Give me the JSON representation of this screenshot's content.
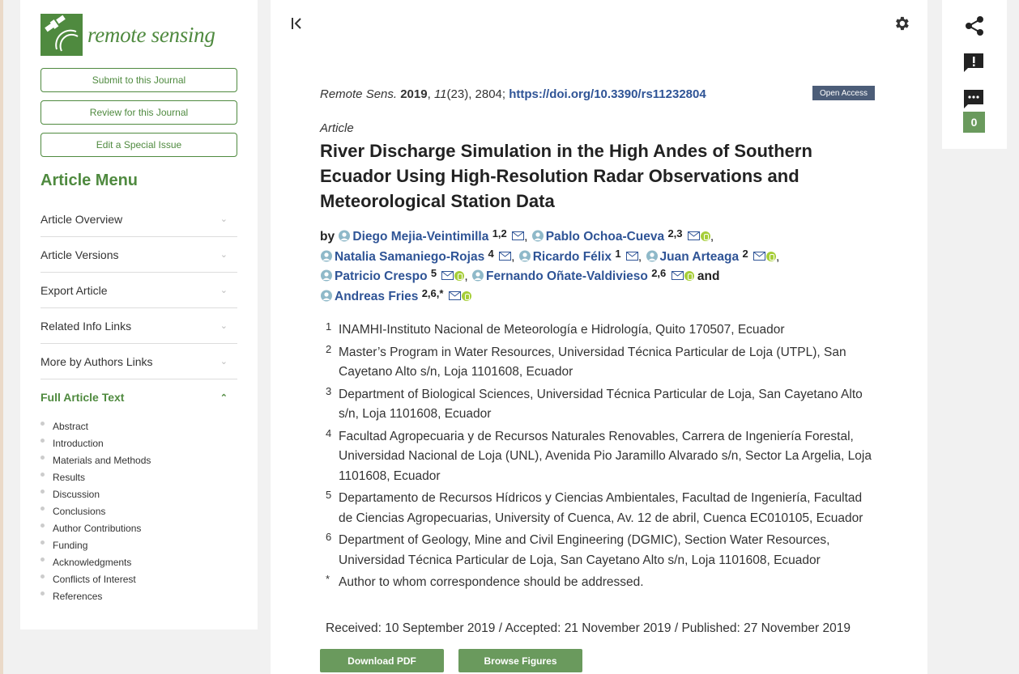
{
  "journal": {
    "name": "remote sensing"
  },
  "sidebar": {
    "buttons": [
      "Submit to this Journal",
      "Review for this Journal",
      "Edit a Special Issue"
    ],
    "menu_title": "Article Menu",
    "menu_items": [
      "Article Overview",
      "Article Versions",
      "Export Article",
      "Related Info Links",
      "More by Authors Links"
    ],
    "full_text_label": "Full Article Text",
    "sections": [
      "Abstract",
      "Introduction",
      "Materials and Methods",
      "Results",
      "Discussion",
      "Conclusions",
      "Author Contributions",
      "Funding",
      "Acknowledgments",
      "Conflicts of Interest",
      "References"
    ]
  },
  "citation": {
    "journal": "Remote Sens.",
    "year": "2019",
    "volume": "11",
    "issue_pages": "(23), 2804;",
    "doi": "https://doi.org/10.3390/rs11232804",
    "badge": "Open Access"
  },
  "article": {
    "type": "Article",
    "title": "River Discharge Simulation in the High Andes of Southern Ecuador Using High-Resolution Radar Observations and Meteorological Station Data",
    "by": "by",
    "and": "and",
    "authors": [
      {
        "name": "Diego Mejia-Veintimilla",
        "sup": "1,2"
      },
      {
        "name": "Pablo Ochoa-Cueva",
        "sup": "2,3"
      },
      {
        "name": "Natalia Samaniego-Rojas",
        "sup": "4"
      },
      {
        "name": "Ricardo Félix",
        "sup": "1"
      },
      {
        "name": "Juan Arteaga",
        "sup": "2"
      },
      {
        "name": "Patricio Crespo",
        "sup": "5"
      },
      {
        "name": "Fernando Oñate-Valdivieso",
        "sup": "2,6"
      },
      {
        "name": "Andreas Fries",
        "sup": "2,6,*"
      }
    ],
    "affiliations": [
      {
        "num": "1",
        "text": "INAMHI-Instituto Nacional de Meteorología e Hidrología, Quito 170507, Ecuador"
      },
      {
        "num": "2",
        "text": "Master’s Program in Water Resources, Universidad Técnica Particular de Loja (UTPL), San Cayetano Alto s/n, Loja 1101608, Ecuador"
      },
      {
        "num": "3",
        "text": "Department of Biological Sciences, Universidad Técnica Particular de Loja, San Cayetano Alto s/n, Loja 1101608, Ecuador"
      },
      {
        "num": "4",
        "text": "Facultad Agropecuaria y de Recursos Naturales Renovables, Carrera de Ingeniería Forestal, Universidad Nacional de Loja (UNL), Avenida Pio Jaramillo Alvarado s/n, Sector La Argelia, Loja 1101608, Ecuador"
      },
      {
        "num": "5",
        "text": "Departamento de Recursos Hídricos y Ciencias Ambientales, Facultad de Ingeniería, Facultad de Ciencias Agropecuarias, University of Cuenca, Av. 12 de abril, Cuenca EC010105, Ecuador"
      },
      {
        "num": "6",
        "text": "Department of Geology, Mine and Civil Engineering (DGMIC), Section Water Resources, Universidad Técnica Particular de Loja, San Cayetano Alto s/n, Loja 1101608, Ecuador"
      },
      {
        "num": "*",
        "text": "Author to whom correspondence should be addressed."
      }
    ],
    "dates": "Received: 10 September 2019 / Accepted: 21 November 2019 / Published: 27 November 2019",
    "download_label": "Download PDF",
    "figures_label": "Browse Figures"
  },
  "right_panel": {
    "comment_count": "0"
  },
  "colors": {
    "brand_green": "#4f8a3f",
    "button_green": "#6a9a5d",
    "link_blue": "#2f5496",
    "badge": "#4c5d78"
  }
}
